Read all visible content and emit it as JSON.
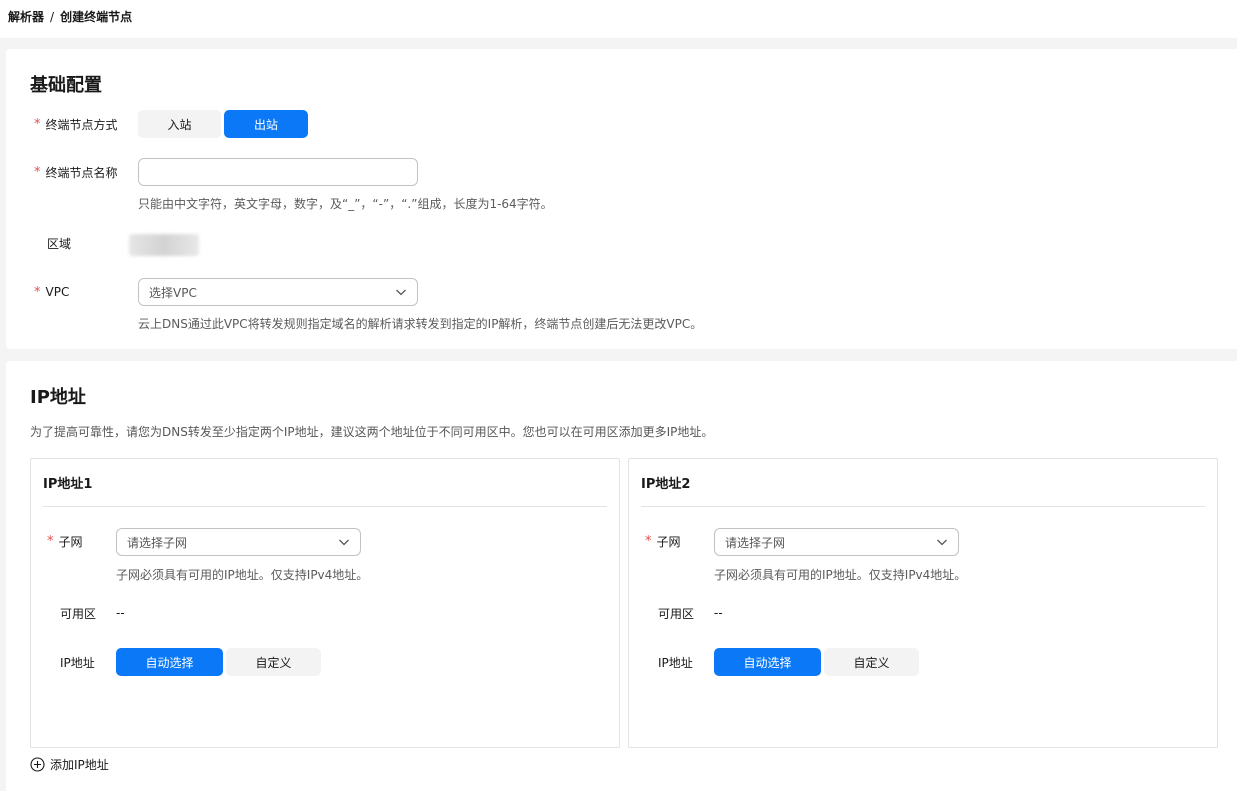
{
  "breadcrumb": {
    "parent": "解析器",
    "separator": "/",
    "current": "创建终端节点"
  },
  "basic": {
    "title": "基础配置",
    "mode": {
      "label": "终端节点方式",
      "options": [
        "入站",
        "出站"
      ],
      "selected": "出站"
    },
    "name": {
      "label": "终端节点名称",
      "value": "",
      "placeholder": "",
      "hint": "只能由中文字符，英文字母，数字，及“_”，“-”，“.”组成，长度为1-64字符。"
    },
    "region": {
      "label": "区域"
    },
    "vpc": {
      "label": "VPC",
      "placeholder": "选择VPC",
      "hint": "云上DNS通过此VPC将转发规则指定域名的解析请求转发到指定的IP解析，终端节点创建后无法更改VPC。"
    }
  },
  "ip": {
    "title": "IP地址",
    "desc": "为了提高可靠性，请您为DNS转发至少指定两个IP地址，建议这两个地址位于不同可用区中。您也可以在可用区添加更多IP地址。",
    "boxes": [
      {
        "title": "IP地址1",
        "subnet_label": "子网",
        "subnet_placeholder": "请选择子网",
        "subnet_hint": "子网必须具有可用的IP地址。仅支持IPv4地址。",
        "az_label": "可用区",
        "az_value": "--",
        "ip_label": "IP地址",
        "ip_options": [
          "自动选择",
          "自定义"
        ],
        "ip_selected": "自动选择"
      },
      {
        "title": "IP地址2",
        "subnet_label": "子网",
        "subnet_placeholder": "请选择子网",
        "subnet_hint": "子网必须具有可用的IP地址。仅支持IPv4地址。",
        "az_label": "可用区",
        "az_value": "--",
        "ip_label": "IP地址",
        "ip_options": [
          "自动选择",
          "自定义"
        ],
        "ip_selected": "自动选择"
      }
    ],
    "add_label": "添加IP地址"
  },
  "colors": {
    "accent": "#0b79f7",
    "required": "#e84e4e"
  }
}
